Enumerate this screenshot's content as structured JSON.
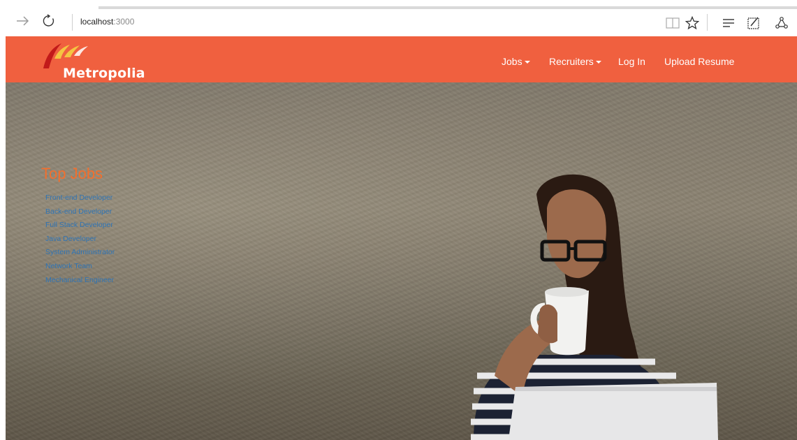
{
  "browser": {
    "url_host": "localhost",
    "url_port": ":3000",
    "icons": [
      "back-arrow-icon",
      "refresh-icon",
      "reading-view-icon",
      "favorite-star-icon",
      "hub-icon",
      "web-note-icon",
      "share-icon"
    ]
  },
  "navbar": {
    "brand": "Metropolia",
    "items": [
      {
        "label": "Jobs",
        "has_dropdown": true
      },
      {
        "label": "Recruiters",
        "has_dropdown": true
      },
      {
        "label": "Log In",
        "has_dropdown": false
      },
      {
        "label": "Upload Resume",
        "has_dropdown": false
      }
    ],
    "color": "#f0603f"
  },
  "hero": {
    "title": "Top Jobs",
    "title_color": "#f36f2d",
    "link_color": "#2f74b5",
    "jobs": [
      "Front-end Developer",
      "Back-end Developer",
      "Full Stack Developer",
      "Java Developer",
      "System Administrator",
      "Network Team",
      "Mechanical Engineer"
    ]
  }
}
